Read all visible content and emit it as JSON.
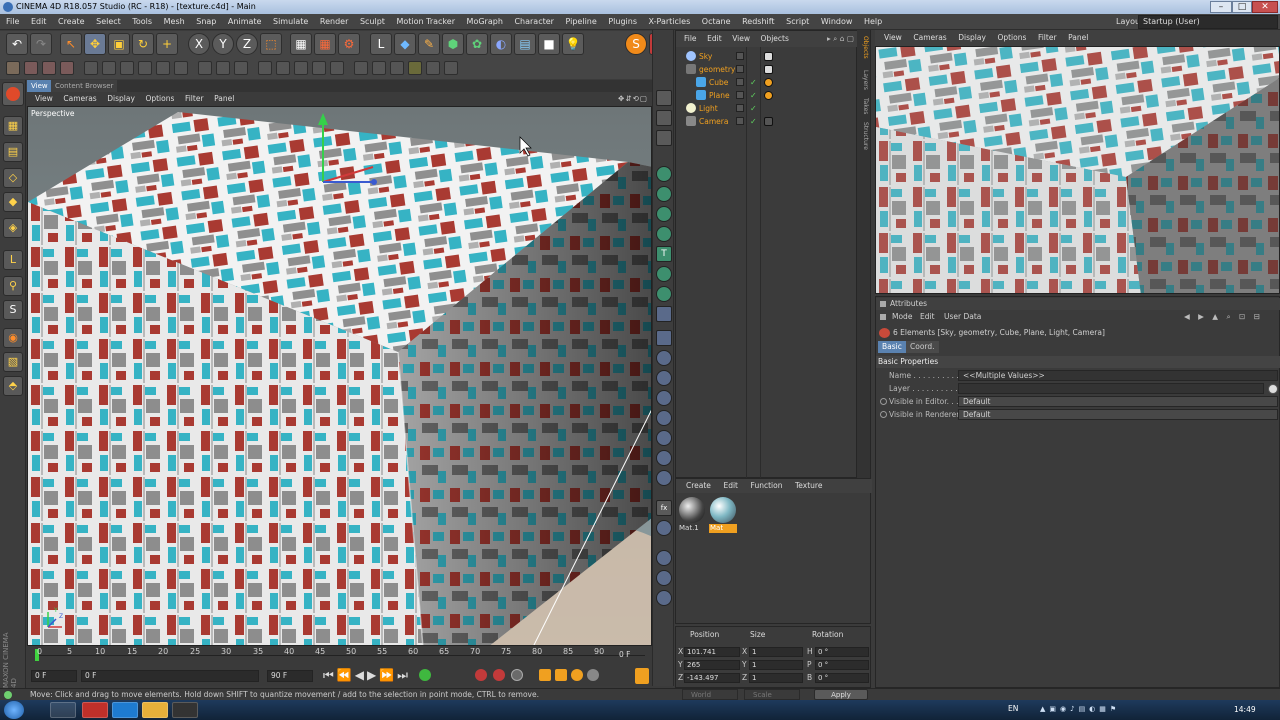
{
  "window": {
    "title": "CINEMA 4D R18.057 Studio (RC - R18) - [texture.c4d] - Main"
  },
  "menubar": [
    "File",
    "Edit",
    "Create",
    "Select",
    "Tools",
    "Mesh",
    "Snap",
    "Animate",
    "Simulate",
    "Render",
    "Sculpt",
    "Motion Tracker",
    "MoGraph",
    "Character",
    "Pipeline",
    "Plugins",
    "X-Particles",
    "Octane",
    "Redshift",
    "Script",
    "Window",
    "Help"
  ],
  "layout": {
    "label": "Layout:",
    "value": "Startup (User)"
  },
  "viewport": {
    "tabs": [
      "View",
      "Content Browser"
    ],
    "menu": [
      "View",
      "Cameras",
      "Display",
      "Options",
      "Filter",
      "Panel"
    ],
    "label": "Perspective",
    "axis_labels": {
      "y": "Y",
      "z": "Z"
    }
  },
  "timeline": {
    "ticks": [
      "0",
      "5",
      "10",
      "15",
      "20",
      "25",
      "30",
      "35",
      "40",
      "45",
      "50",
      "55",
      "60",
      "65",
      "70",
      "75",
      "80",
      "85",
      "90"
    ],
    "current_frame": "0 F",
    "start_field": "0 F",
    "start_value": "0 F",
    "end_field": "90 F",
    "end_value": "90 F"
  },
  "object_manager": {
    "menu": [
      "File",
      "Edit",
      "View",
      "Objects"
    ],
    "objects": [
      {
        "name": "Sky",
        "indent": 0,
        "color": "#9fc4ff"
      },
      {
        "name": "geometry",
        "indent": 0,
        "color": "#d0d0d0"
      },
      {
        "name": "Cube",
        "indent": 1,
        "color": "#4aa6e8"
      },
      {
        "name": "Plane",
        "indent": 1,
        "color": "#4aa6e8"
      },
      {
        "name": "Light",
        "indent": 0,
        "color": "#f2f2d0"
      },
      {
        "name": "Camera",
        "indent": 0,
        "color": "#cccccc"
      }
    ],
    "side_tabs": [
      "Objects",
      "Layers",
      "Takes",
      "Structure"
    ]
  },
  "material_manager": {
    "menu": [
      "Create",
      "Edit",
      "Function",
      "Texture"
    ],
    "materials": [
      {
        "name": "Mat.1",
        "selected": false
      },
      {
        "name": "Mat",
        "selected": true
      }
    ]
  },
  "coordinates": {
    "headers": [
      "Position",
      "Size",
      "Rotation"
    ],
    "rows": [
      {
        "axis": "X",
        "pos": "101.741",
        "size_axis": "X",
        "size": "1",
        "rot_axis": "H",
        "rot": "0 °"
      },
      {
        "axis": "Y",
        "pos": "265",
        "size_axis": "Y",
        "size": "1",
        "rot_axis": "P",
        "rot": "0 °"
      },
      {
        "axis": "Z",
        "pos": "-143.497",
        "size_axis": "Z",
        "size": "1",
        "rot_axis": "B",
        "rot": "0 °"
      }
    ],
    "mode1": "World",
    "mode2": "Scale",
    "apply": "Apply"
  },
  "render_view": {
    "menu": [
      "View",
      "Cameras",
      "Display",
      "Options",
      "Filter",
      "Panel"
    ]
  },
  "attributes": {
    "title": "Attributes",
    "menu": [
      "Mode",
      "Edit",
      "User Data"
    ],
    "selection": "6 Elements [Sky, geometry, Cube, Plane, Light, Camera]",
    "tabs": [
      "Basic",
      "Coord."
    ],
    "section": "Basic Properties",
    "fields": [
      {
        "label": "Name . . . . . . . . . . . .",
        "value": "<<Multiple Values>>"
      },
      {
        "label": "Layer . . . . . . . . . . . .",
        "value": ""
      },
      {
        "label": "Visible in Editor. . .",
        "value": "Default"
      },
      {
        "label": "Visible in Renderer",
        "value": "Default"
      }
    ]
  },
  "status": "Move: Click and drag to move elements. Hold down SHIFT to quantize movement / add to the selection in point mode, CTRL to remove.",
  "taskbar": {
    "lang": "EN",
    "time": "14:49"
  },
  "brand": {
    "line1": "MAXON",
    "line2": "CINEMA 4D"
  },
  "colors": {
    "accent": "#f0a020",
    "tab_active": "#5a82b0",
    "cube_teal": "#36b3c4",
    "cube_red": "#a93a32"
  }
}
